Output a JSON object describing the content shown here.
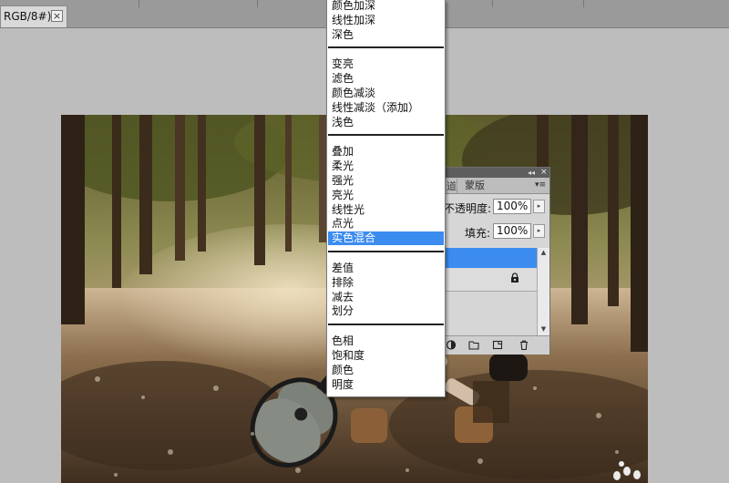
{
  "document_tab": {
    "title": "RGB/8#) *",
    "close_glyph": "×"
  },
  "layers_panel": {
    "tab_masks": "蒙版",
    "tab_channels_partial": "道",
    "opacity_label": "不透明度:",
    "opacity_value": "100%",
    "fill_label": "填充:",
    "fill_value": "100%",
    "collapse_glyph": "◂◂",
    "close_glyph": "×",
    "menu_glyph": "▾≡",
    "icons": [
      "lock-icon",
      "adjustment-layer-icon",
      "folder-icon",
      "new-layer-icon",
      "trash-icon"
    ]
  },
  "blend_menu": {
    "highlighted": "实色混合",
    "groups": [
      [
        "颜色加深",
        "线性加深",
        "深色"
      ],
      [
        "变亮",
        "滤色",
        "颜色减淡",
        "线性减淡（添加）",
        "浅色"
      ],
      [
        "叠加",
        "柔光",
        "强光",
        "亮光",
        "线性光",
        "点光",
        "实色混合"
      ],
      [
        "差值",
        "排除",
        "减去",
        "划分"
      ],
      [
        "色相",
        "饱和度",
        "颜色",
        "明度"
      ]
    ]
  },
  "colors": {
    "highlight": "#3c8cf0",
    "workspace": "#bdbdbd"
  }
}
